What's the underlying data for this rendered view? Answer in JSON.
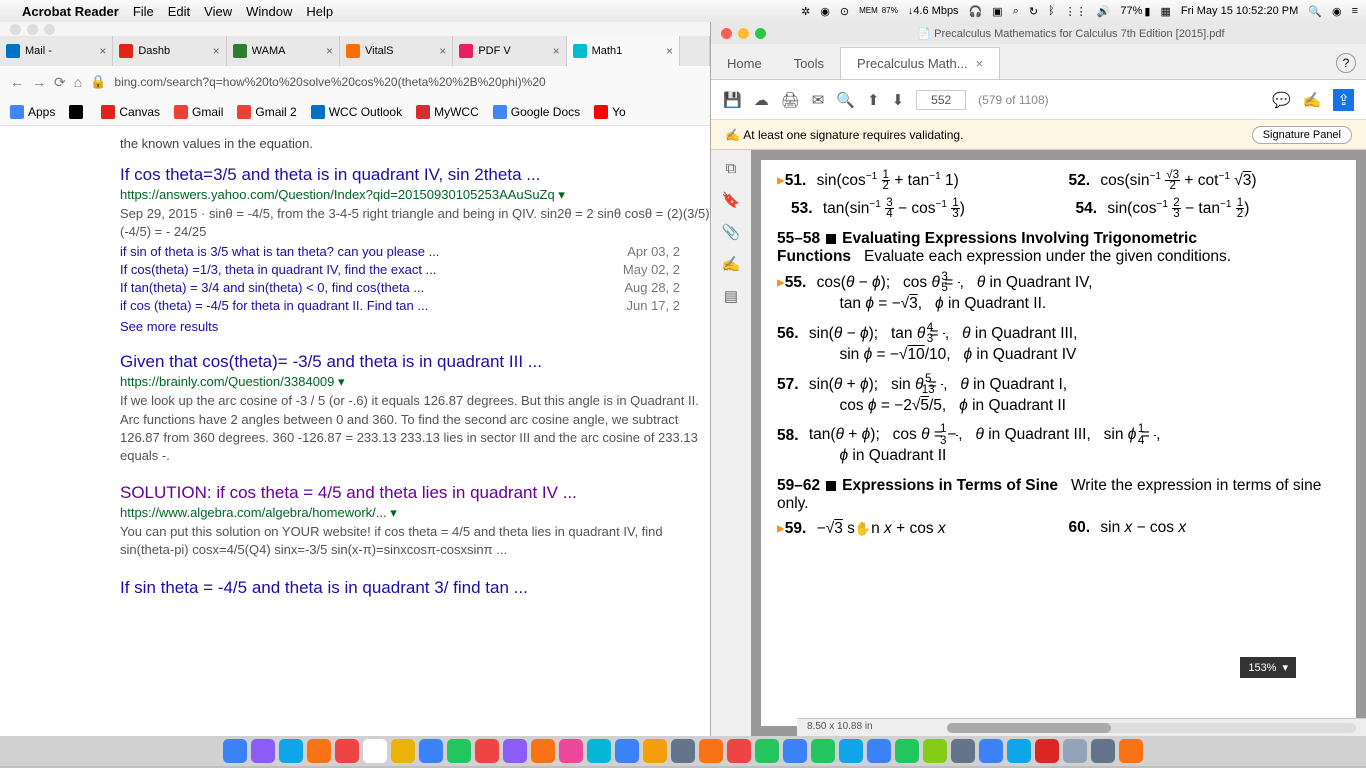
{
  "menubar": {
    "app": "Acrobat Reader",
    "items": [
      "File",
      "Edit",
      "View",
      "Window",
      "Help"
    ],
    "mem": "MEM",
    "mem_pct": "87%",
    "net": "↓4.6 Mbps",
    "batt": "77%",
    "date": "Fri May 15  10:52:20 PM"
  },
  "chrome": {
    "tabs": [
      {
        "t": "Mail -",
        "c": "#0072c6"
      },
      {
        "t": "Dashb",
        "c": "#e2231a"
      },
      {
        "t": "WAMA",
        "c": "#2e7d32"
      },
      {
        "t": "VitalS",
        "c": "#ff6f00"
      },
      {
        "t": "PDF V",
        "c": "#e91e63"
      },
      {
        "t": "Math1",
        "c": "#00bcd4"
      }
    ],
    "url": "bing.com/search?q=how%20to%20solve%20cos%20(theta%20%2B%20phi)%20",
    "bookmarks": [
      {
        "t": "Apps",
        "c": "#4285f4"
      },
      {
        "t": "",
        "c": "#000"
      },
      {
        "t": "Canvas",
        "c": "#e2231a"
      },
      {
        "t": "Gmail",
        "c": "#ea4335"
      },
      {
        "t": "Gmail 2",
        "c": "#ea4335"
      },
      {
        "t": "WCC Outlook",
        "c": "#0072c6"
      },
      {
        "t": "MyWCC",
        "c": "#d32f2f"
      },
      {
        "t": "Google Docs",
        "c": "#4285f4"
      },
      {
        "t": "Yo",
        "c": "#ff0000"
      }
    ],
    "snip0": "the known values in the equation.",
    "r1": {
      "t": "If cos theta=3/5 and theta is in quadrant IV, sin 2theta ...",
      "u": "https://answers.yahoo.com/Question/Index?qid=20150930105253AAuSuZq ▾",
      "s": "Sep 29, 2015 · sinθ = -4/5, from the 3-4-5 right triangle and being in QIV. sin2θ = 2 sinθ cosθ = (2)(3/5)(-4/5) = - 24/25"
    },
    "rel": [
      {
        "t": "if sin of theta is 3/5 what is tan theta? can you please ...",
        "d": "Apr 03, 2"
      },
      {
        "t": "If cos(theta) =1/3, theta in quadrant IV, find the exact ...",
        "d": "May 02, 2"
      },
      {
        "t": "If tan(theta) = 3/4 and sin(theta) < 0, find cos(theta ...",
        "d": "Aug 28, 2"
      },
      {
        "t": "if cos (theta) = -4/5 for theta in quadrant II. Find tan ...",
        "d": "Jun 17, 2"
      }
    ],
    "smr": "See more results",
    "r2": {
      "t": "Given that cos(theta)= -3/5 and theta is in quadrant III ...",
      "u": "https://brainly.com/Question/3384009 ▾",
      "s": "If we look up the arc cosine of -3 / 5 (or -.6) it equals 126.87 degrees. But this angle is in Quadrant II. Arc functions have 2 angles between 0 and 360. To find the second arc cosine angle, we subtract 126.87 from 360 degrees. 360 -126.87 = 233.13 233.13 lies in sector III and the arc cosine of 233.13 equals -."
    },
    "r3": {
      "t": "SOLUTION: if cos theta = 4/5 and theta lies in quadrant IV ...",
      "u": "https://www.algebra.com/algebra/homework/... ▾",
      "s": "You can put this solution on YOUR website! if cos theta = 4/5 and theta lies in quadrant IV, find sin(theta-pi) cosx=4/5(Q4) sinx=-3/5 sin(x-π)=sinxcosπ-cosxsinπ ..."
    },
    "r4": {
      "t": "If sin theta = -4/5 and theta is in quadrant 3/ find tan ..."
    }
  },
  "acrobat": {
    "title": "Precalculus Mathematics for Calculus 7th Edition [2015].pdf",
    "tabs": [
      "Home",
      "Tools"
    ],
    "doctab": "Precalculus Math...",
    "page": "552",
    "pagetotal": "(579 of 1108)",
    "sigmsg": "At least one signature requires validating.",
    "sigbtn": "Signature Panel",
    "sec1a": "55–58",
    "sec1b": "Evaluating Expressions Involving Trigonometric Functions",
    "sec1c": "Evaluate each expression under the given conditions.",
    "sec2a": "59–62",
    "sec2b": "Expressions in Terms of Sine",
    "sec2c": "Write the expression in terms of sine only.",
    "zoom": "153%",
    "psize": "8.50 x 10.88 in"
  }
}
